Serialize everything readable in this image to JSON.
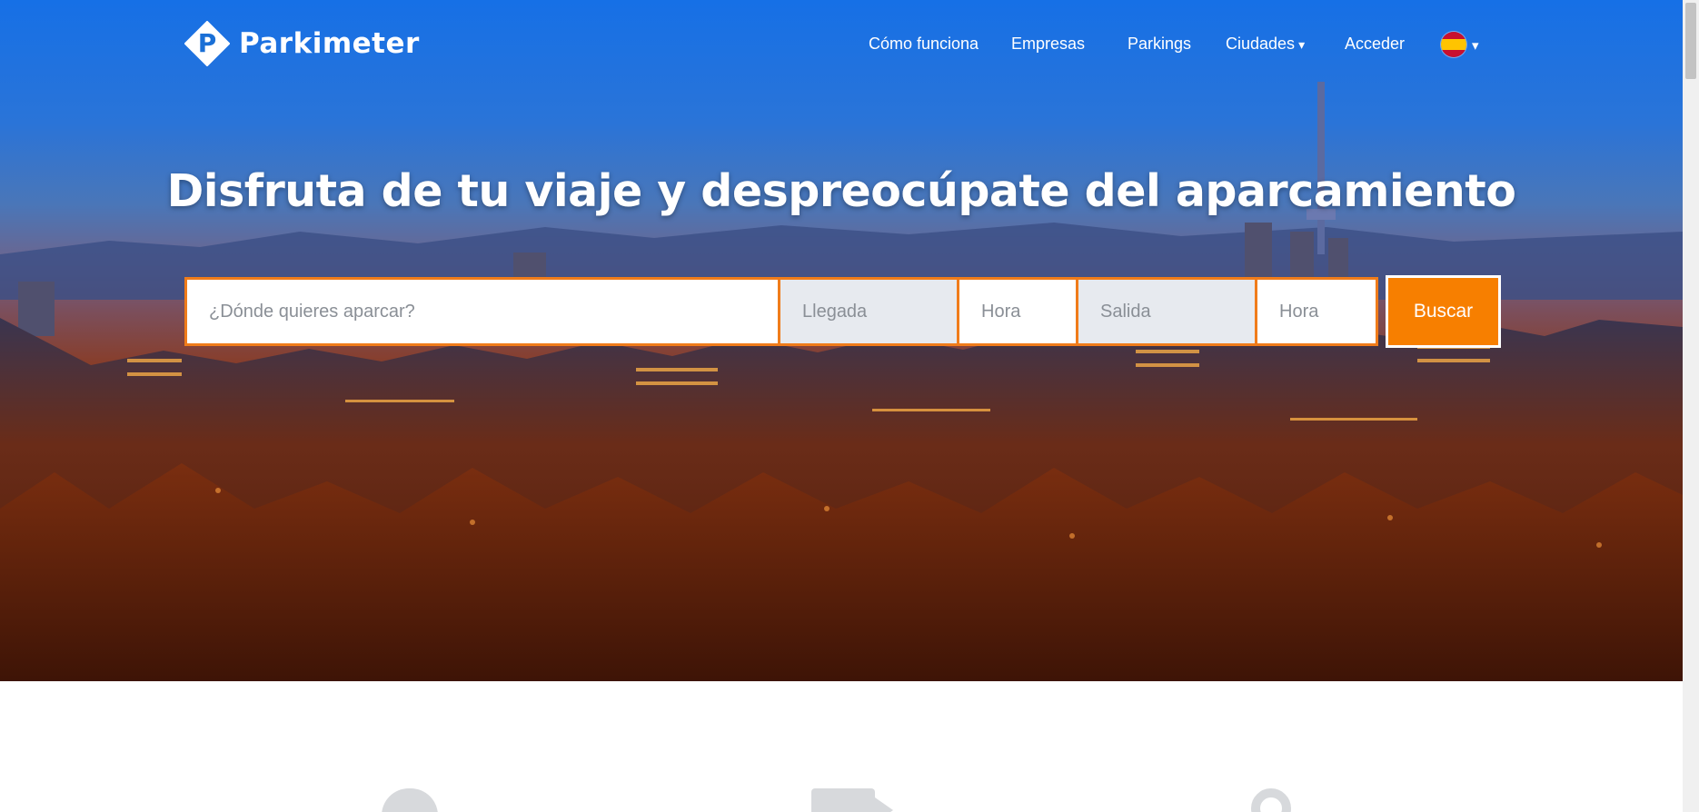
{
  "brand": {
    "logo_letter": "P",
    "name": "Parkimeter"
  },
  "nav": {
    "items": [
      {
        "label": "Cómo funciona"
      },
      {
        "label": "Empresas"
      },
      {
        "label": "Parkings"
      },
      {
        "label": "Ciudades",
        "caret": "▾"
      },
      {
        "label": "Acceder"
      }
    ],
    "language_caret": "▾",
    "language_icon": "spain-flag-icon"
  },
  "hero": {
    "headline": "Disfruta de tu viaje y despreocúpate del aparcamiento"
  },
  "search": {
    "where_placeholder": "¿Dónde quieres aparcar?",
    "arrival_placeholder": "Llegada",
    "arrival_time_placeholder": "Hora",
    "departure_placeholder": "Salida",
    "departure_time_placeholder": "Hora",
    "submit_label": "Buscar"
  },
  "features": {
    "icons": [
      "heart-icon",
      "video-camera-icon",
      "location-pin-icon"
    ]
  },
  "colors": {
    "accent_orange": "#f77f00",
    "field_border": "#f07c1a",
    "hero_top_blue": "#1670e6"
  }
}
